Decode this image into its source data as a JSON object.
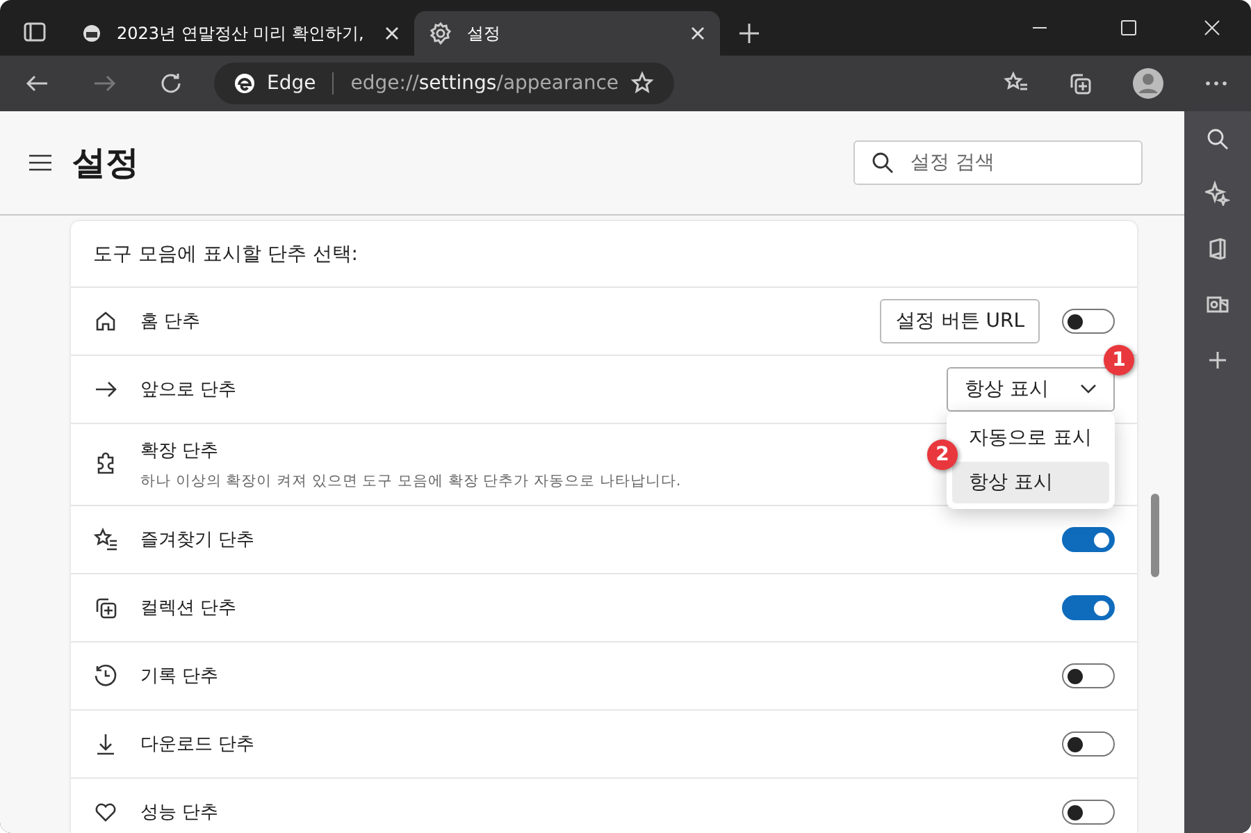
{
  "tabs": [
    {
      "title": "2023년 연말정산 미리 확인하기,",
      "selected": false
    },
    {
      "title": "설정",
      "selected": true
    }
  ],
  "address": {
    "brand": "Edge",
    "scheme": "edge://",
    "host": "settings",
    "path": "/appearance"
  },
  "header": {
    "title": "설정",
    "search_placeholder": "설정 검색"
  },
  "section_title": "도구 모음에 표시할 단추 선택:",
  "rows": [
    {
      "kind": "toggle",
      "label": "홈 단추",
      "button": "설정 버튼 URL",
      "on": false
    },
    {
      "kind": "select",
      "label": "앞으로 단추",
      "value": "항상 표시",
      "expanded": true,
      "options": [
        {
          "label": "자동으로 표시",
          "selected": false
        },
        {
          "label": "항상 표시",
          "selected": true
        }
      ]
    },
    {
      "kind": "note",
      "label": "확장 단추",
      "description": "하나 이상의 확장이 켜져 있으면 도구 모음에 확장 단추가 자동으로 나타납니다."
    },
    {
      "kind": "toggle",
      "label": "즐겨찾기 단추",
      "on": true
    },
    {
      "kind": "toggle",
      "label": "컬렉션 단추",
      "on": true
    },
    {
      "kind": "toggle",
      "label": "기록 단추",
      "on": false
    },
    {
      "kind": "toggle",
      "label": "다운로드 단추",
      "on": false
    },
    {
      "kind": "toggle",
      "label": "성능 단추",
      "on": false
    }
  ],
  "callouts": [
    "1",
    "2"
  ]
}
